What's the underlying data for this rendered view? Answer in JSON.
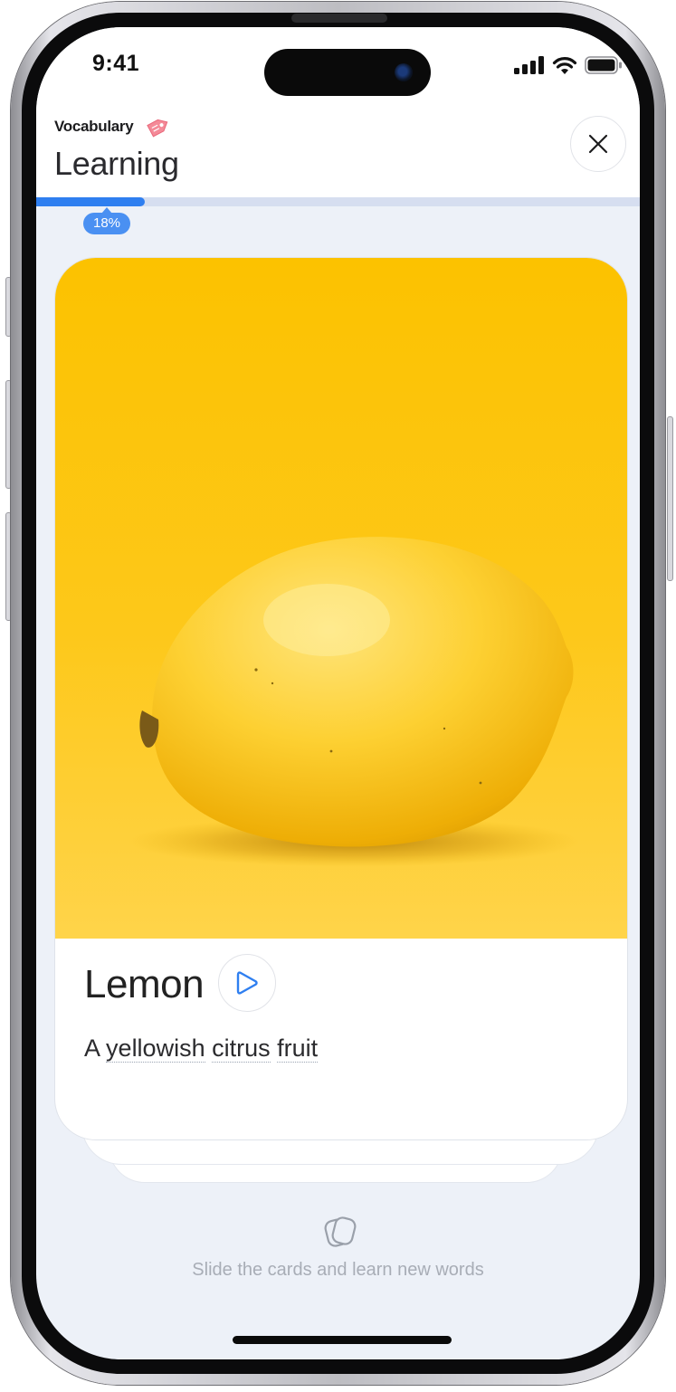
{
  "status_bar": {
    "time": "9:41"
  },
  "header": {
    "breadcrumb": "Vocabulary",
    "title": "Learning",
    "close_icon": "close-icon",
    "tag_icon": "tag-icon"
  },
  "progress": {
    "value": 0.18,
    "label": "18%"
  },
  "card": {
    "image": "lemon-photo",
    "word": "Lemon",
    "play_icon": "play-icon",
    "definition": [
      "A",
      "yellowish",
      "citrus",
      "fruit"
    ]
  },
  "hint": {
    "icon": "cards-icon",
    "text": "Slide the cards and learn new words"
  },
  "colors": {
    "accent": "#2f7ff0",
    "card_bg": "#ffffff",
    "screen_bg": "#edf1f8",
    "photo_bg": "#fbc400"
  }
}
